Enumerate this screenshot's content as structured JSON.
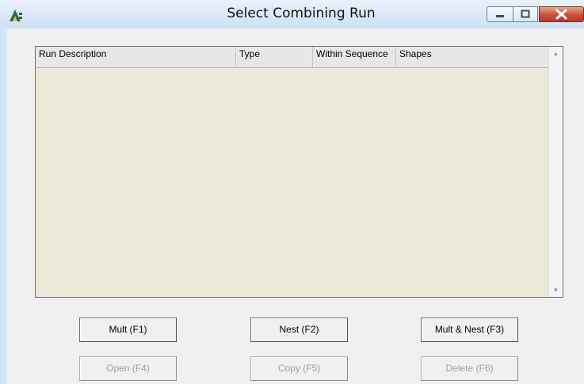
{
  "window": {
    "title": "Select Combining Run",
    "icon": "app-triangle-icon",
    "controls": {
      "minimize": "minimize-icon",
      "maximize": "maximize-icon",
      "close": "close-icon"
    }
  },
  "list": {
    "columns": [
      "Run Description",
      "Type",
      "Within Sequence",
      "Shapes"
    ],
    "rows": []
  },
  "buttons": {
    "row1": [
      "Mult (F1)",
      "Nest (F2)",
      "Mult & Nest (F3)"
    ],
    "row2": [
      "Open (F4)",
      "Copy (F5)",
      "Delete (F6)"
    ]
  },
  "colors": {
    "list_bg": "#ece9d8",
    "close_button": "#c9503b",
    "disabled_text": "#a0a0a0"
  }
}
